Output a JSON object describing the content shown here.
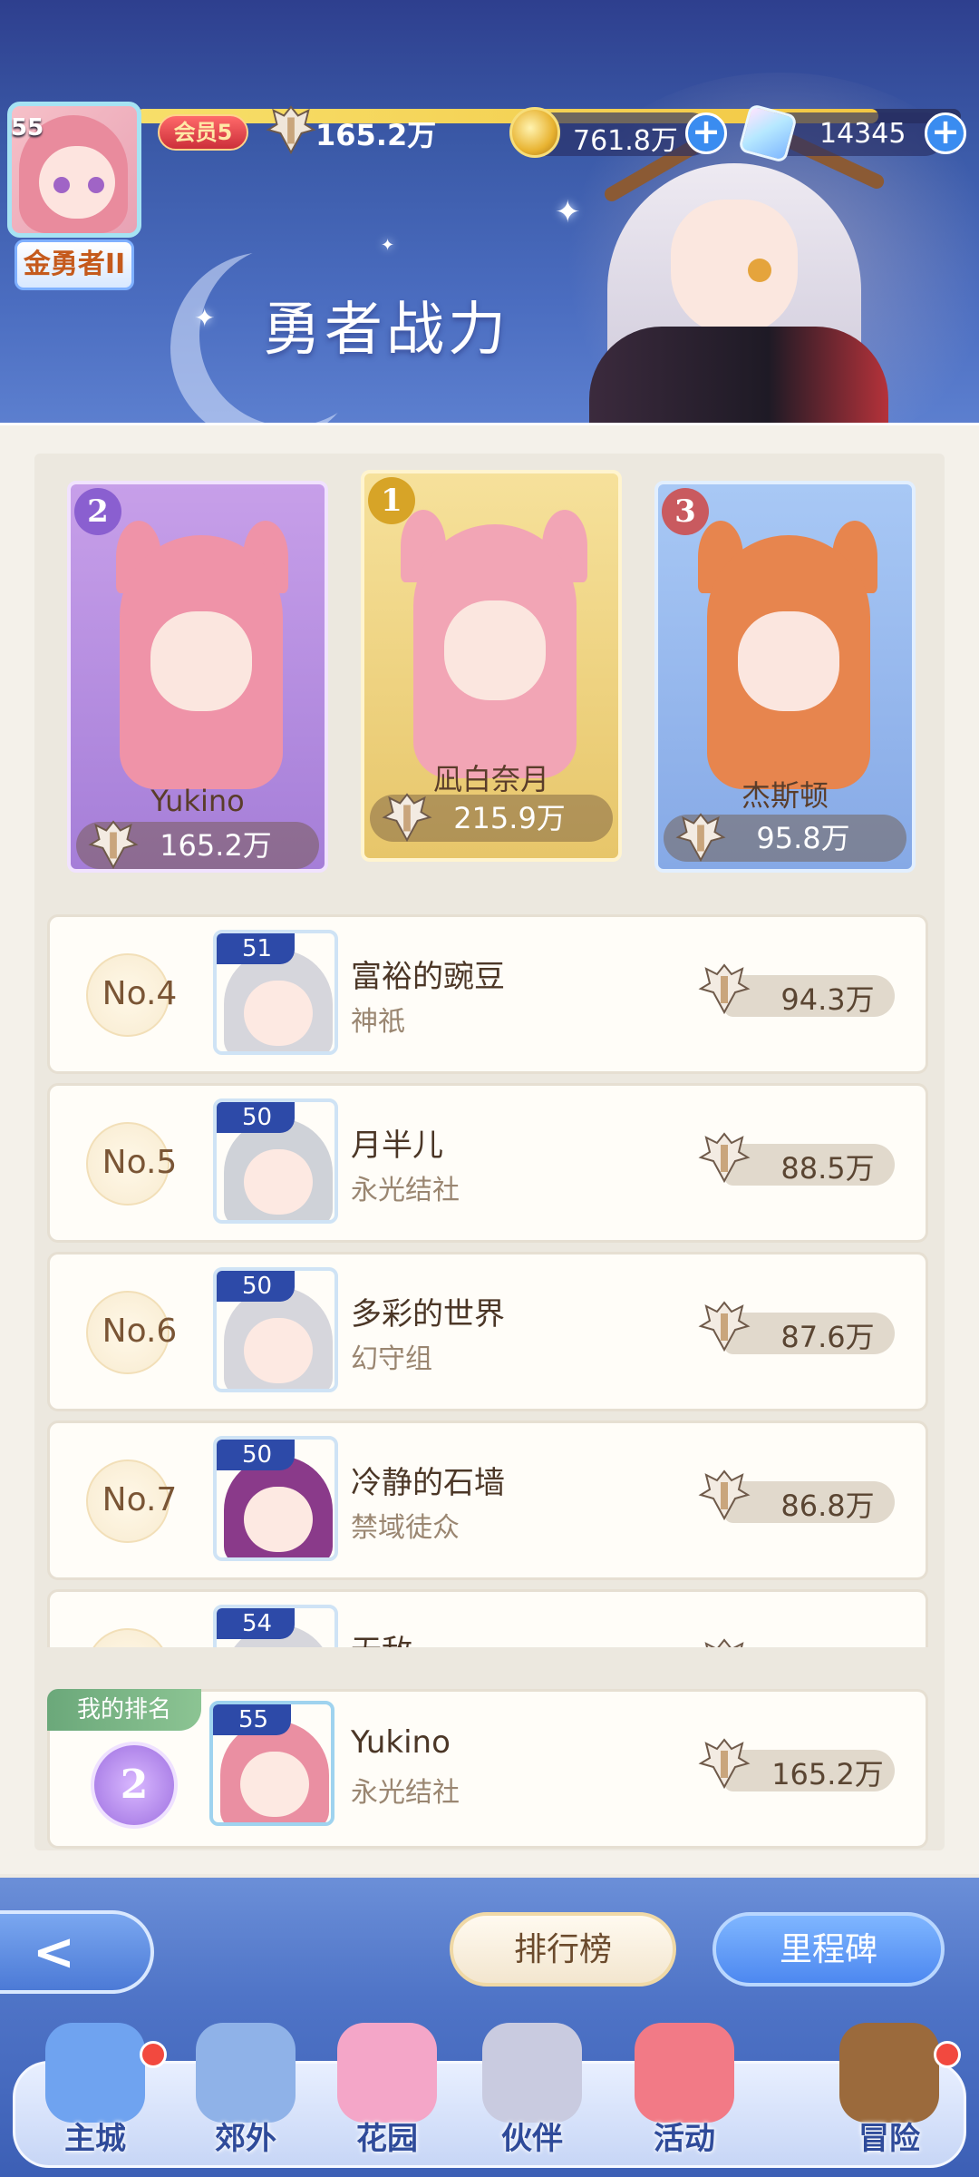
{
  "header": {
    "player_level": "55",
    "title_badge": "金勇者II",
    "vip_label": "会员5",
    "power": "165.2万",
    "power_bar_progress": 0.9,
    "coins": "761.8万",
    "gems": "14345",
    "page_title": "勇者战力"
  },
  "podium": [
    {
      "rank": "2",
      "name": "Yukino",
      "power": "165.2万",
      "color": "#a57ed8",
      "hair": "#ef93a8"
    },
    {
      "rank": "1",
      "name": "凪白奈月",
      "power": "215.9万",
      "color": "#e7c66a",
      "hair": "#f2a5b5"
    },
    {
      "rank": "3",
      "name": "杰斯顿",
      "power": "95.8万",
      "color": "#86a9e6",
      "hair": "#e7854e"
    }
  ],
  "ranking": [
    {
      "rank": "No.4",
      "level": "51",
      "name": "富裕的豌豆",
      "guild": "神祇",
      "power": "94.3万",
      "hair": "#d6d6dc"
    },
    {
      "rank": "No.5",
      "level": "50",
      "name": "月半儿",
      "guild": "永光结社",
      "power": "88.5万",
      "hair": "#cfd2d8"
    },
    {
      "rank": "No.6",
      "level": "50",
      "name": "多彩的世界",
      "guild": "幻守组",
      "power": "87.6万",
      "hair": "#d6d6dc"
    },
    {
      "rank": "No.7",
      "level": "50",
      "name": "冷静的石墙",
      "guild": "禁域徒众",
      "power": "86.8万",
      "hair": "#8a3a8a"
    },
    {
      "rank": "",
      "level": "54",
      "name": "无敌",
      "guild": "",
      "power": "",
      "hair": "#d6d6dc"
    }
  ],
  "my_rank": {
    "tag": "我的排名",
    "rank": "2",
    "level": "55",
    "name": "Yukino",
    "guild": "永光结社",
    "power": "165.2万"
  },
  "buttons": {
    "back": "<",
    "leaderboard": "排行榜",
    "milestone": "里程碑"
  },
  "nav": [
    {
      "label": "主城",
      "icon": "castle-icon",
      "badge": true
    },
    {
      "label": "郊外",
      "icon": "portal-icon",
      "badge": false
    },
    {
      "label": "花园",
      "icon": "heart-icon",
      "badge": false
    },
    {
      "label": "伙伴",
      "icon": "partner-icon",
      "badge": false
    },
    {
      "label": "活动",
      "icon": "gift-icon",
      "badge": false
    },
    {
      "label": "冒险",
      "icon": "compass-icon",
      "badge": true
    }
  ]
}
